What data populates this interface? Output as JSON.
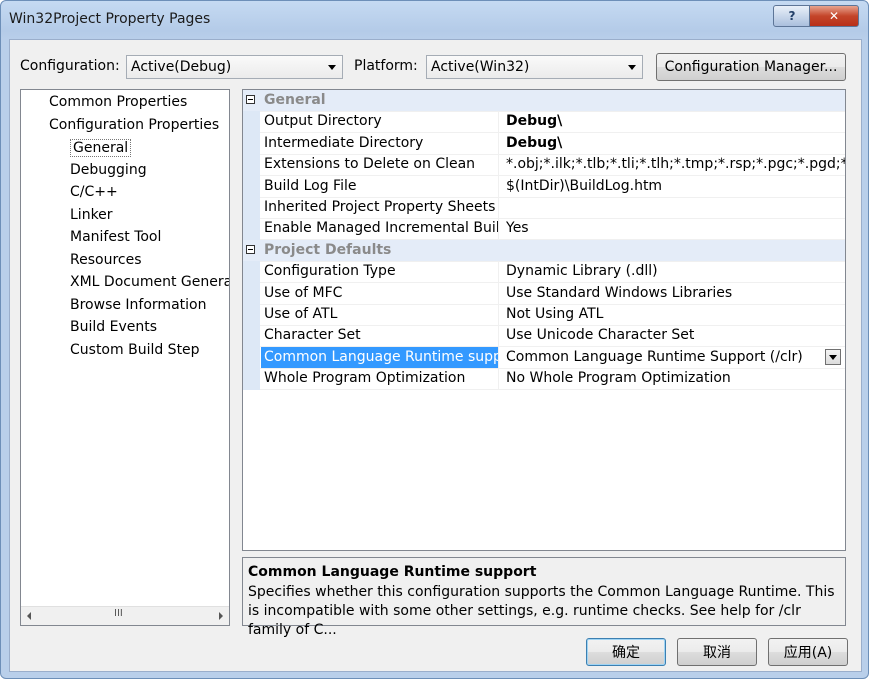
{
  "window": {
    "title": "Win32Project Property Pages",
    "help_label": "?",
    "close_label": "✕"
  },
  "toolbar": {
    "configuration_label": "Configuration:",
    "configuration_value": "Active(Debug)",
    "platform_label": "Platform:",
    "platform_value": "Active(Win32)",
    "configuration_manager_label": "Configuration Manager..."
  },
  "tree": {
    "items": [
      {
        "label": "Common Properties"
      },
      {
        "label": "Configuration Properties"
      },
      {
        "label": "General",
        "selected": true
      },
      {
        "label": "Debugging"
      },
      {
        "label": "C/C++"
      },
      {
        "label": "Linker"
      },
      {
        "label": "Manifest Tool"
      },
      {
        "label": "Resources"
      },
      {
        "label": "XML Document Generat"
      },
      {
        "label": "Browse Information"
      },
      {
        "label": "Build Events"
      },
      {
        "label": "Custom Build Step"
      }
    ],
    "scroll_grip": "III"
  },
  "grid": {
    "categories": [
      {
        "name": "General",
        "rows": [
          {
            "name": "Output Directory",
            "value": "Debug\\",
            "bold": true
          },
          {
            "name": "Intermediate Directory",
            "value": "Debug\\",
            "bold": true
          },
          {
            "name": "Extensions to Delete on Clean",
            "value": "*.obj;*.ilk;*.tlb;*.tli;*.tlh;*.tmp;*.rsp;*.pgc;*.pgd;*.meta;$"
          },
          {
            "name": "Build Log File",
            "value": "$(IntDir)\\BuildLog.htm"
          },
          {
            "name": "Inherited Project Property Sheets",
            "value": ""
          },
          {
            "name": "Enable Managed Incremental Build",
            "value": "Yes"
          }
        ]
      },
      {
        "name": "Project Defaults",
        "rows": [
          {
            "name": "Configuration Type",
            "value": "Dynamic Library (.dll)"
          },
          {
            "name": "Use of MFC",
            "value": "Use Standard Windows Libraries"
          },
          {
            "name": "Use of ATL",
            "value": "Not Using ATL"
          },
          {
            "name": "Character Set",
            "value": "Use Unicode Character Set"
          },
          {
            "name": "Common Language Runtime suppor",
            "value": "Common Language Runtime Support (/clr)",
            "selected": true
          },
          {
            "name": "Whole Program Optimization",
            "value": "No Whole Program Optimization"
          }
        ]
      }
    ]
  },
  "description": {
    "title": "Common Language Runtime support",
    "text": "Specifies whether this configuration supports the Common Language Runtime.  This is incompatible with some other settings, e.g. runtime checks. See help for /clr family of C..."
  },
  "buttons": {
    "ok": "确定",
    "cancel": "取消",
    "apply": "应用(A)"
  }
}
